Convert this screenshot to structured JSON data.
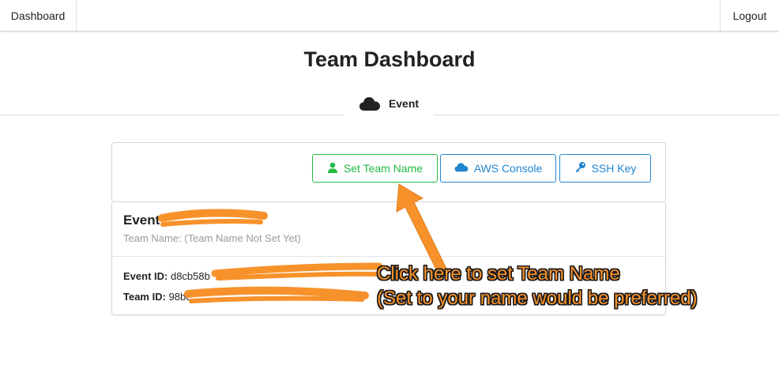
{
  "nav": {
    "left_label": "Dashboard",
    "right_label": "Logout"
  },
  "page": {
    "title": "Team Dashboard"
  },
  "event_tab": {
    "label": "Event",
    "icon": "cloud-icon"
  },
  "buttons": {
    "set_team_name": {
      "label": "Set Team Name",
      "icon": "user-icon",
      "color": "#21ba45"
    },
    "aws_console": {
      "label": "AWS Console",
      "icon": "cloud-icon",
      "color": "#2185d0"
    },
    "ssh_key": {
      "label": "SSH Key",
      "icon": "key-icon",
      "color": "#2185d0"
    }
  },
  "card": {
    "title": "Event",
    "meta": "Team Name: (Team Name Not Set Yet)",
    "event_id": {
      "label": "Event ID:",
      "value": "d8cb58b"
    },
    "team_id": {
      "label": "Team ID:",
      "value": "98be"
    }
  },
  "annotation": {
    "line1": "Click here to set Team Name",
    "line2": "(Set to your name would be preferred)",
    "color": "#f7922b"
  }
}
